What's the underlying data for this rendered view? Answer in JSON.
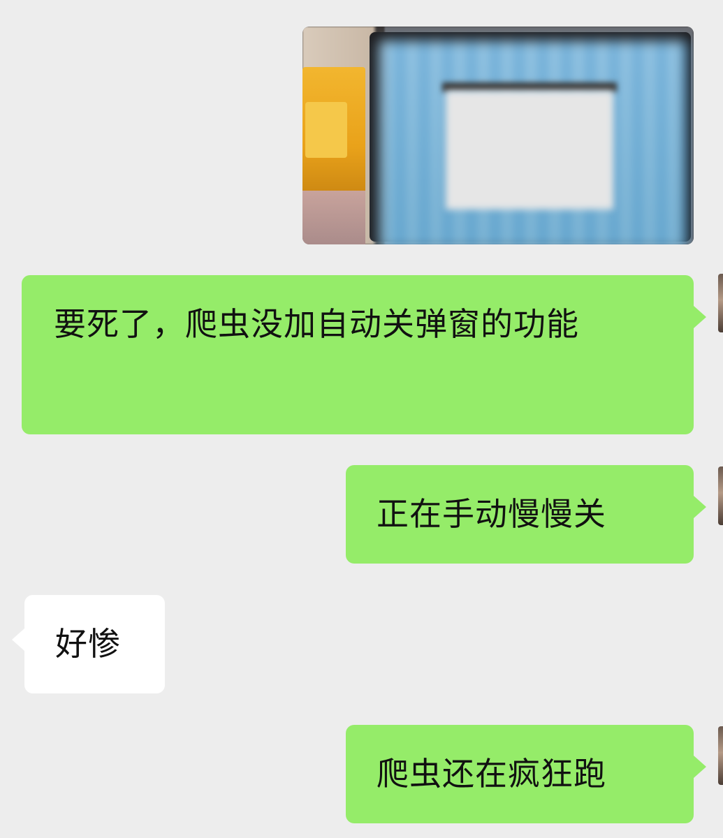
{
  "colors": {
    "background": "#ededed",
    "sent_bubble": "#95ec69",
    "received_bubble": "#ffffff",
    "text": "#111111"
  },
  "messages": [
    {
      "direction": "sent",
      "type": "image"
    },
    {
      "direction": "sent",
      "type": "text",
      "text": "要死了，爬虫没加自动关弹窗的功能"
    },
    {
      "direction": "sent",
      "type": "text",
      "text": "正在手动慢慢关"
    },
    {
      "direction": "received",
      "type": "text",
      "text": "好惨"
    },
    {
      "direction": "sent",
      "type": "text",
      "text": "爬虫还在疯狂跑"
    }
  ]
}
